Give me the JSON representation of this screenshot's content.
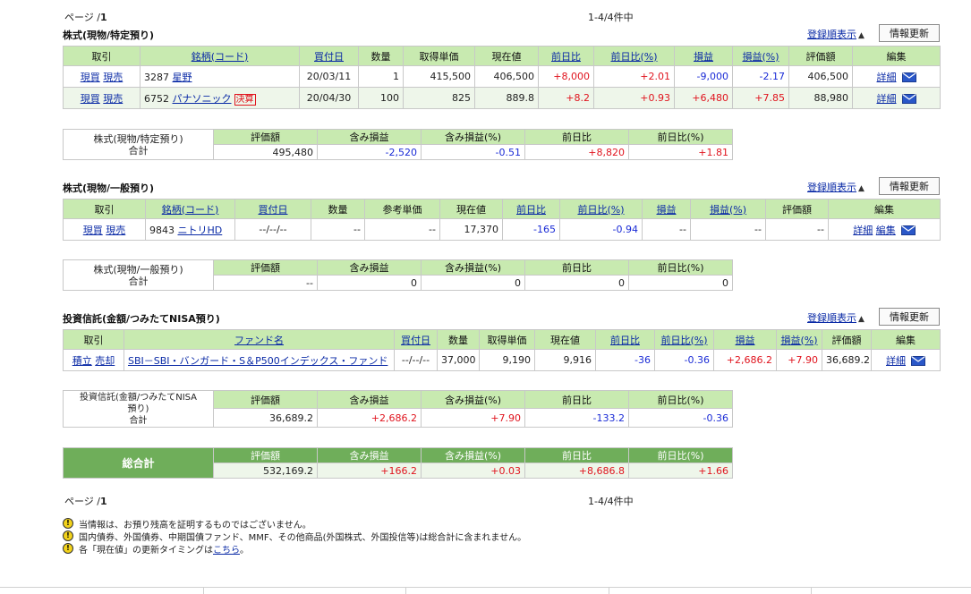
{
  "pager_top": {
    "prefix": "ページ /",
    "page": "1",
    "count": "1-4/4件中"
  },
  "pager_bottom": {
    "prefix": "ページ /",
    "page": "1",
    "count": "1-4/4件中"
  },
  "common": {
    "sort_label": "登録順表示",
    "refresh_label": "情報更新",
    "mail_icon": "mail-icon"
  },
  "stocks_tokutei": {
    "title": "株式(現物/特定預り)",
    "headers": [
      "取引",
      "銘柄(コード)",
      "買付日",
      "数量",
      "取得単価",
      "現在値",
      "前日比",
      "前日比(%)",
      "損益",
      "損益(%)",
      "評価額",
      "編集"
    ],
    "rows": [
      {
        "buy": "現買",
        "sell": "現売",
        "code": "3287",
        "name": "星野",
        "badge": "",
        "date": "20/03/11",
        "qty": "1",
        "cost": "415,500",
        "price": "406,500",
        "chg": "+8,000",
        "chg_pct": "+2.01",
        "pl": "-9,000",
        "pl_pct": "-2.17",
        "value": "406,500",
        "detail": "詳細"
      },
      {
        "buy": "現買",
        "sell": "現売",
        "code": "6752",
        "name": "パナソニック",
        "badge": "決算",
        "date": "20/04/30",
        "qty": "100",
        "cost": "825",
        "price": "889.8",
        "chg": "+8.2",
        "chg_pct": "+0.93",
        "pl": "+6,480",
        "pl_pct": "+7.85",
        "value": "88,980",
        "detail": "詳細"
      }
    ],
    "summary": {
      "label1": "株式(現物/特定預り)",
      "label2": "合計",
      "headers": [
        "評価額",
        "含み損益",
        "含み損益(%)",
        "前日比",
        "前日比(%)"
      ],
      "values": [
        "495,480",
        "-2,520",
        "-0.51",
        "+8,820",
        "+1.81"
      ]
    }
  },
  "stocks_ippan": {
    "title": "株式(現物/一般預り)",
    "headers": [
      "取引",
      "銘柄(コード)",
      "買付日",
      "数量",
      "参考単価",
      "現在値",
      "前日比",
      "前日比(%)",
      "損益",
      "損益(%)",
      "評価額",
      "編集"
    ],
    "rows": [
      {
        "buy": "現買",
        "sell": "現売",
        "code": "9843",
        "name": "ニトリHD",
        "date": "--/--/--",
        "qty": "--",
        "cost": "--",
        "price": "17,370",
        "chg": "-165",
        "chg_pct": "-0.94",
        "pl": "--",
        "pl_pct": "--",
        "value": "--",
        "detail": "詳細",
        "edit": "編集"
      }
    ],
    "summary": {
      "label1": "株式(現物/一般預り)",
      "label2": "合計",
      "headers": [
        "評価額",
        "含み損益",
        "含み損益(%)",
        "前日比",
        "前日比(%)"
      ],
      "values": [
        "--",
        "0",
        "0",
        "0",
        "0"
      ]
    }
  },
  "funds": {
    "title": "投資信託(金額/つみたてNISA預り)",
    "headers": [
      "取引",
      "ファンド名",
      "買付日",
      "数量",
      "取得単価",
      "現在値",
      "前日比",
      "前日比(%)",
      "損益",
      "損益(%)",
      "評価額",
      "編集"
    ],
    "rows": [
      {
        "buy": "積立",
        "sell": "売却",
        "name": "SBI－SBI・バンガード・S＆P500インデックス・ファンド",
        "date": "--/--/--",
        "qty": "37,000",
        "cost": "9,190",
        "price": "9,916",
        "chg": "-36",
        "chg_pct": "-0.36",
        "pl": "+2,686.2",
        "pl_pct": "+7.90",
        "value": "36,689.2",
        "detail": "詳細"
      }
    ],
    "summary": {
      "label1": "投資信託(金額/つみたてNISA",
      "label1b": "預り)",
      "label2": "合計",
      "headers": [
        "評価額",
        "含み損益",
        "含み損益(%)",
        "前日比",
        "前日比(%)"
      ],
      "values": [
        "36,689.2",
        "+2,686.2",
        "+7.90",
        "-133.2",
        "-0.36"
      ]
    }
  },
  "grand_total": {
    "label": "総合計",
    "headers": [
      "評価額",
      "含み損益",
      "含み損益(%)",
      "前日比",
      "前日比(%)"
    ],
    "values": [
      "532,169.2",
      "+166.2",
      "+0.03",
      "+8,686.8",
      "+1.66"
    ]
  },
  "notes": [
    {
      "text": "当情報は、お預り残高を証明するものではございません。",
      "link": ""
    },
    {
      "text": "国内債券、外国債券、中期国債ファンド、MMF、その他商品(外国株式、外国投信等)は総合計に含まれません。",
      "link": ""
    },
    {
      "text": "各「現在値」の更新タイミングは",
      "link": "こちら",
      "tail": "。"
    }
  ],
  "colors": {
    "positive": "#e0141e",
    "negative": "#1a2bd6",
    "header_bg": "#c8eab0",
    "total_bg": "#6fae5a",
    "link": "#0a2aa6"
  }
}
